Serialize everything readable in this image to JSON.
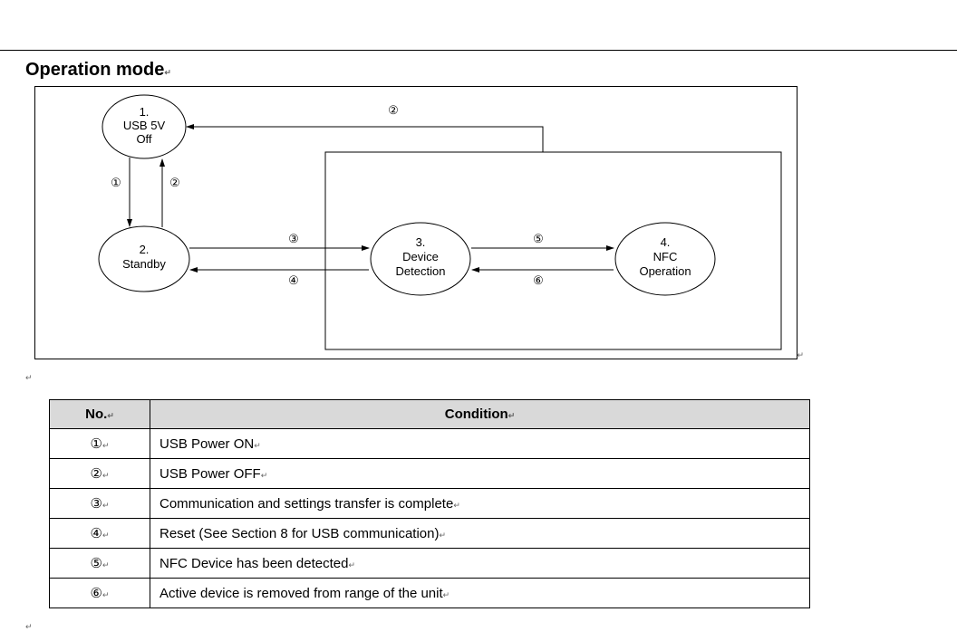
{
  "title": "Operation mode",
  "nodes": {
    "n1": {
      "line1": "1.",
      "line2": "USB 5V",
      "line3": "Off"
    },
    "n2": {
      "line1": "2.",
      "line2": "Standby",
      "line3": ""
    },
    "n3": {
      "line1": "3.",
      "line2": "Device",
      "line3": "Detection"
    },
    "n4": {
      "line1": "4.",
      "line2": "NFC",
      "line3": "Operation"
    }
  },
  "edgeLabels": {
    "e1": "①",
    "e2": "②",
    "e3": "③",
    "e4": "④",
    "e5": "⑤",
    "e6": "⑥"
  },
  "table": {
    "headers": {
      "no": "No.",
      "condition": "Condition"
    },
    "rows": [
      {
        "no": "①",
        "cond": "USB Power ON"
      },
      {
        "no": "②",
        "cond": "USB Power OFF"
      },
      {
        "no": "③",
        "cond": "Communication and settings transfer is complete"
      },
      {
        "no": "④",
        "cond": "Reset (See Section 8 for USB communication)"
      },
      {
        "no": "⑤",
        "cond": "NFC Device has been detected"
      },
      {
        "no": "⑥",
        "cond": "Active device is removed from range of the unit"
      }
    ]
  },
  "cr": "↵"
}
